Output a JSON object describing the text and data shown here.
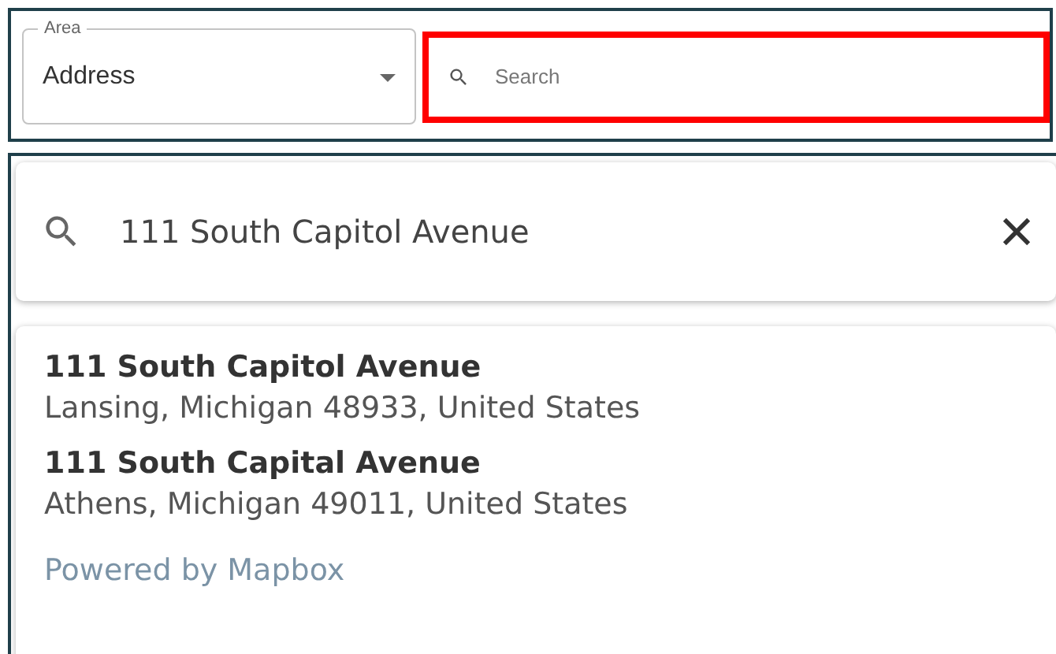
{
  "area_select": {
    "label": "Area",
    "value": "Address"
  },
  "search_field": {
    "placeholder": "Search",
    "highlighted": true
  },
  "geocoder": {
    "query": "111 South Capitol Avenue",
    "results": [
      {
        "title": "111 South Capitol Avenue",
        "subtitle": "Lansing, Michigan 48933, United States"
      },
      {
        "title": "111 South Capital Avenue",
        "subtitle": "Athens, Michigan 49011, United States"
      }
    ],
    "attribution": "Powered by Mapbox"
  }
}
